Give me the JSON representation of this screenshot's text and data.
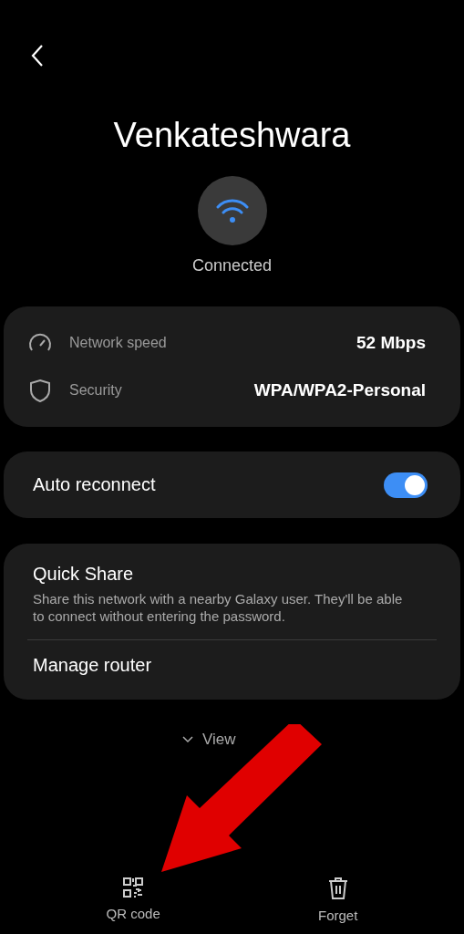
{
  "header": {
    "title": "Venkateshwara",
    "status": "Connected"
  },
  "details": [
    {
      "kind": "speed",
      "label": "Network speed",
      "value": "52 Mbps"
    },
    {
      "kind": "security",
      "label": "Security",
      "value": "WPA/WPA2-Personal"
    }
  ],
  "auto_reconnect": {
    "label": "Auto reconnect",
    "on": true
  },
  "options": [
    {
      "title": "Quick Share",
      "description": "Share this network with a nearby Galaxy user. They'll be able to connect without entering the password."
    },
    {
      "title": "Manage router"
    }
  ],
  "view_more": "View",
  "actions": [
    {
      "kind": "qr",
      "label": "QR code"
    },
    {
      "kind": "trash",
      "label": "Forget"
    }
  ]
}
